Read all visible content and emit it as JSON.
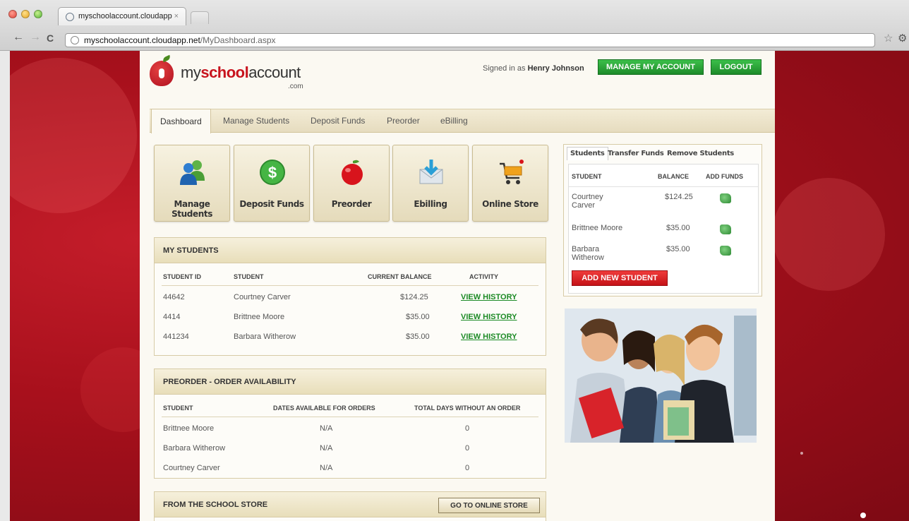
{
  "browser": {
    "tab_title": "myschoolaccount.cloudapp",
    "tab_close": "×",
    "url_domain": "myschoolaccount.cloudapp.net",
    "url_path": "/MyDashboard.aspx",
    "back": "←",
    "forward": "→",
    "reload": "C",
    "star": "☆",
    "wrench": "🔧"
  },
  "header": {
    "logo_prefix": "my",
    "logo_brand": "school",
    "logo_suffix": "account",
    "logo_com": ".com",
    "signed_in_label": "Signed in as",
    "user_name": "Henry Johnson",
    "manage_account": "MANAGE MY ACCOUNT",
    "logout": "LOGOUT"
  },
  "nav": [
    "Dashboard",
    "Manage Students",
    "Deposit Funds",
    "Preorder",
    "eBilling"
  ],
  "tiles": [
    "Manage Students",
    "Deposit Funds",
    "Preorder",
    "Ebilling",
    "Online Store"
  ],
  "my_students": {
    "title": "MY STUDENTS",
    "columns": [
      "STUDENT ID",
      "STUDENT",
      "CURRENT BALANCE",
      "ACTIVITY"
    ],
    "rows": [
      {
        "id": "44642",
        "name": "Courtney Carver",
        "balance": "$124.25",
        "activity": "VIEW HISTORY"
      },
      {
        "id": "4414",
        "name": "Brittnee Moore",
        "balance": "$35.00",
        "activity": "VIEW HISTORY"
      },
      {
        "id": "441234",
        "name": "Barbara Witherow",
        "balance": "$35.00",
        "activity": "VIEW HISTORY"
      }
    ]
  },
  "preorder": {
    "title": "PREORDER - ORDER AVAILABILITY",
    "columns": [
      "STUDENT",
      "DATES AVAILABLE FOR ORDERS",
      "TOTAL DAYS WITHOUT AN ORDER"
    ],
    "rows": [
      {
        "name": "Brittnee Moore",
        "dates": "N/A",
        "days": "0"
      },
      {
        "name": "Barbara Witherow",
        "dates": "N/A",
        "days": "0"
      },
      {
        "name": "Courtney Carver",
        "dates": "N/A",
        "days": "0"
      }
    ]
  },
  "store": {
    "title": "FROM THE SCHOOL STORE",
    "button": "GO TO ONLINE STORE"
  },
  "sidebox": {
    "tabs": [
      "Students",
      "Transfer Funds",
      "Remove Students"
    ],
    "columns": [
      "STUDENT",
      "BALANCE",
      "ADD FUNDS"
    ],
    "rows": [
      {
        "name": "Courtney Carver",
        "balance": "$124.25"
      },
      {
        "name": "Brittnee Moore",
        "balance": "$35.00"
      },
      {
        "name": "Barbara Witherow",
        "balance": "$35.00"
      }
    ],
    "add_button": "ADD NEW STUDENT"
  },
  "colors": {
    "brand_red": "#c8141e",
    "action_green": "#1d8b2a",
    "link_green": "#1c8a25",
    "beige": "#e8deba"
  }
}
